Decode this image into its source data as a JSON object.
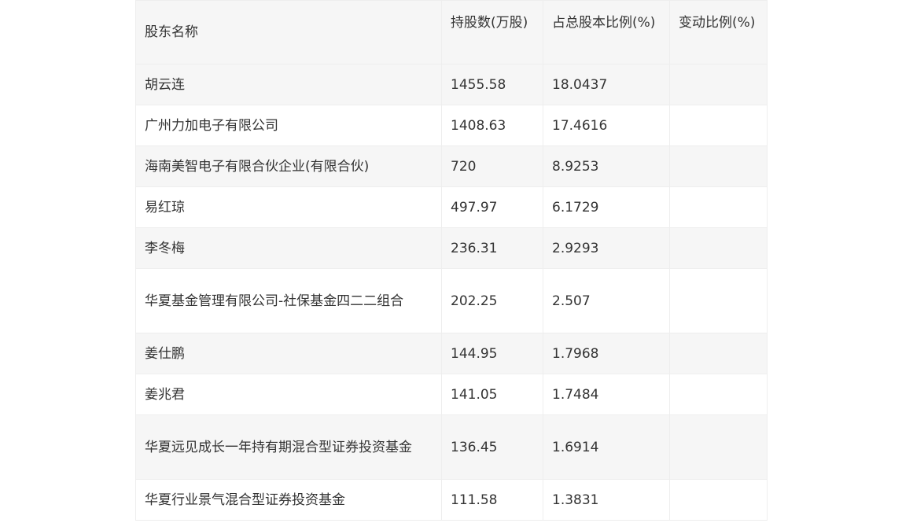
{
  "table": {
    "headers": [
      "股东名称",
      "持股数(万股)",
      "占总股本比例(%)",
      "变动比例(%)"
    ],
    "rows": [
      {
        "name": "胡云连",
        "shares": "1455.58",
        "ratio": "18.0437",
        "change": ""
      },
      {
        "name": "广州力加电子有限公司",
        "shares": "1408.63",
        "ratio": "17.4616",
        "change": ""
      },
      {
        "name": "海南美智电子有限合伙企业(有限合伙)",
        "shares": "720",
        "ratio": "8.9253",
        "change": ""
      },
      {
        "name": "易红琼",
        "shares": "497.97",
        "ratio": "6.1729",
        "change": ""
      },
      {
        "name": "李冬梅",
        "shares": "236.31",
        "ratio": "2.9293",
        "change": ""
      },
      {
        "name": "华夏基金管理有限公司-社保基金四二二组合",
        "shares": "202.25",
        "ratio": "2.507",
        "change": ""
      },
      {
        "name": "姜仕鹏",
        "shares": "144.95",
        "ratio": "1.7968",
        "change": ""
      },
      {
        "name": "姜兆君",
        "shares": "141.05",
        "ratio": "1.7484",
        "change": ""
      },
      {
        "name": "华夏远见成长一年持有期混合型证券投资基金",
        "shares": "136.45",
        "ratio": "1.6914",
        "change": ""
      },
      {
        "name": "华夏行业景气混合型证券投资基金",
        "shares": "111.58",
        "ratio": "1.3831",
        "change": ""
      }
    ]
  }
}
